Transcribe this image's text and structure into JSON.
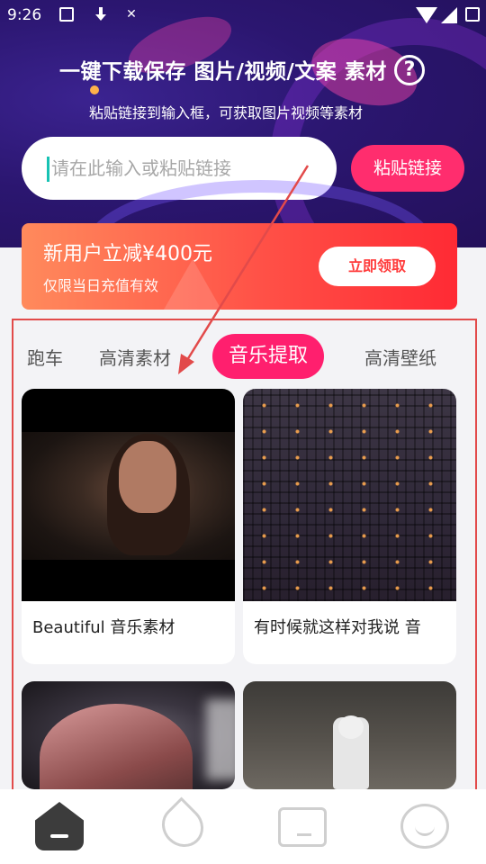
{
  "status_bar": {
    "time": "9:26"
  },
  "header": {
    "title": "一键下载保存 图片/视频/文案 素材",
    "subtitle": "粘贴链接到输入框，可获取图片视频等素材"
  },
  "search": {
    "placeholder": "请在此输入或粘贴链接",
    "value": ""
  },
  "paste_button": {
    "label": "粘贴链接"
  },
  "promo": {
    "title": "新用户立减¥400元",
    "subtitle": "仅限当日充值有效",
    "button_label": "立即领取"
  },
  "tabs": [
    {
      "label": "跑车",
      "active": false
    },
    {
      "label": "高清素材",
      "active": false
    },
    {
      "label": "音乐提取",
      "active": true
    },
    {
      "label": "高清壁纸",
      "active": false
    }
  ],
  "cards": [
    {
      "caption": "Beautiful 音乐素材",
      "thumbnail": "girl-portrait"
    },
    {
      "caption": "有时候就这样对我说 音",
      "thumbnail": "apartment-building-night"
    },
    {
      "caption": "",
      "thumbnail": "helmet"
    },
    {
      "caption": "",
      "thumbnail": "astronaut-landscape"
    }
  ],
  "bottom_nav": [
    {
      "name": "home",
      "icon": "home-icon",
      "active": true
    },
    {
      "name": "drop",
      "icon": "drop-icon",
      "active": false
    },
    {
      "name": "folder",
      "icon": "folder-icon",
      "active": false
    },
    {
      "name": "profile",
      "icon": "profile-icon",
      "active": false
    }
  ],
  "colors": {
    "accent": "#ff1f6e",
    "hero_bg": "#2b1670",
    "promo_start": "#ff8a5c",
    "promo_end": "#ff2a34",
    "annotation": "#e24a4a"
  }
}
